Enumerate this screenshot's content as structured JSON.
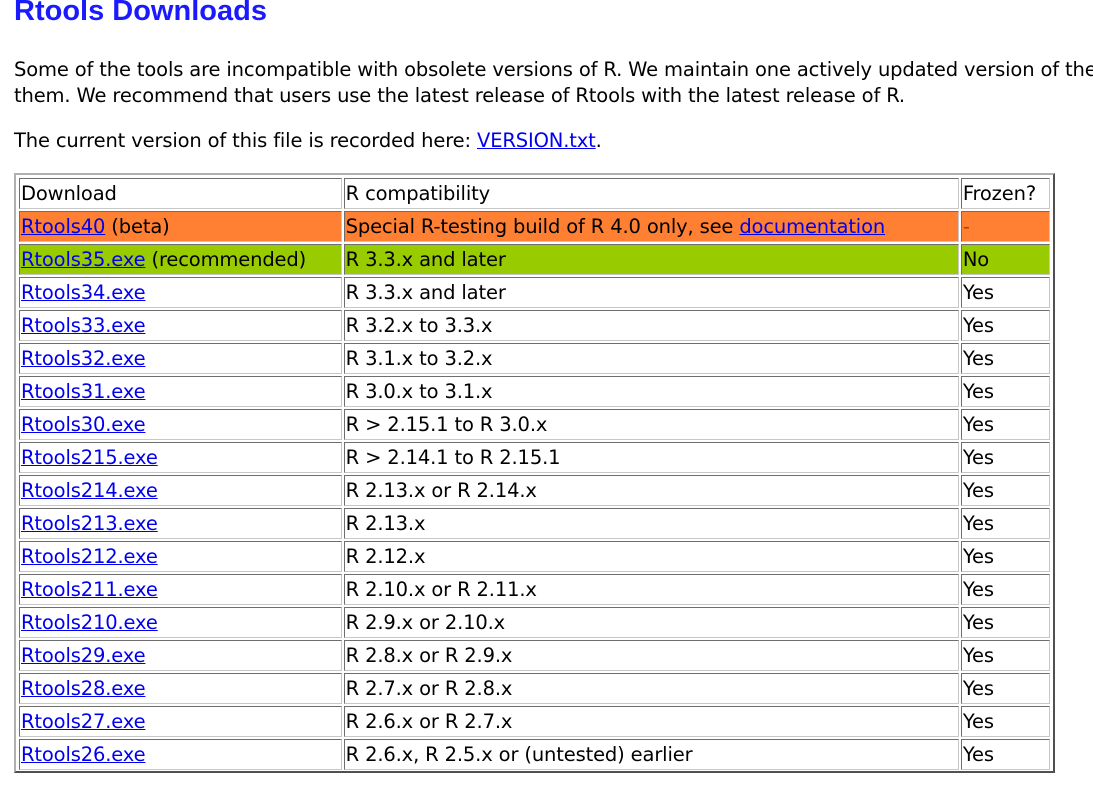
{
  "page": {
    "title": "Rtools Downloads",
    "intro_line1": "Some of the tools are incompatible with obsolete versions of R. We maintain one actively updated version of the",
    "intro_line2": "them. We recommend that users use the latest release of Rtools with the latest release of R.",
    "version_prefix": "The current version of this file is recorded here: ",
    "version_link": "VERSION.txt",
    "version_suffix": "."
  },
  "colors": {
    "title": "#1a1aff",
    "link": "#0000ee",
    "beta_row": "#ff7f33",
    "recommended_row": "#99cc00"
  },
  "table": {
    "headers": [
      "Download",
      "R compatibility",
      "Frozen?"
    ],
    "beta_row": {
      "link": "Rtools40",
      "note": " (beta)",
      "compat_prefix": "Special R-testing build of R 4.0 only, see ",
      "compat_link": "documentation",
      "frozen": "-"
    },
    "recommended_row": {
      "link": "Rtools35.exe",
      "note": " (recommended)",
      "compat": "R 3.3.x and later",
      "frozen": "No"
    },
    "rows": [
      {
        "link": "Rtools34.exe",
        "compat": "R 3.3.x and later",
        "frozen": "Yes"
      },
      {
        "link": "Rtools33.exe",
        "compat": "R 3.2.x to 3.3.x",
        "frozen": "Yes"
      },
      {
        "link": "Rtools32.exe",
        "compat": "R 3.1.x to 3.2.x",
        "frozen": "Yes"
      },
      {
        "link": "Rtools31.exe",
        "compat": "R 3.0.x to 3.1.x",
        "frozen": "Yes"
      },
      {
        "link": "Rtools30.exe",
        "compat": "R > 2.15.1 to R 3.0.x",
        "frozen": "Yes"
      },
      {
        "link": "Rtools215.exe",
        "compat": "R > 2.14.1 to R 2.15.1",
        "frozen": "Yes"
      },
      {
        "link": "Rtools214.exe",
        "compat": "R 2.13.x or R 2.14.x",
        "frozen": "Yes"
      },
      {
        "link": "Rtools213.exe",
        "compat": "R 2.13.x",
        "frozen": "Yes"
      },
      {
        "link": "Rtools212.exe",
        "compat": "R 2.12.x",
        "frozen": "Yes"
      },
      {
        "link": "Rtools211.exe",
        "compat": "R 2.10.x or R 2.11.x",
        "frozen": "Yes"
      },
      {
        "link": "Rtools210.exe",
        "compat": "R 2.9.x or 2.10.x",
        "frozen": "Yes"
      },
      {
        "link": "Rtools29.exe",
        "compat": "R 2.8.x or R 2.9.x",
        "frozen": "Yes"
      },
      {
        "link": "Rtools28.exe",
        "compat": "R 2.7.x or R 2.8.x",
        "frozen": "Yes"
      },
      {
        "link": "Rtools27.exe",
        "compat": "R 2.6.x or R 2.7.x",
        "frozen": "Yes"
      },
      {
        "link": "Rtools26.exe",
        "compat": "R 2.6.x, R 2.5.x or (untested) earlier",
        "frozen": "Yes"
      }
    ]
  }
}
